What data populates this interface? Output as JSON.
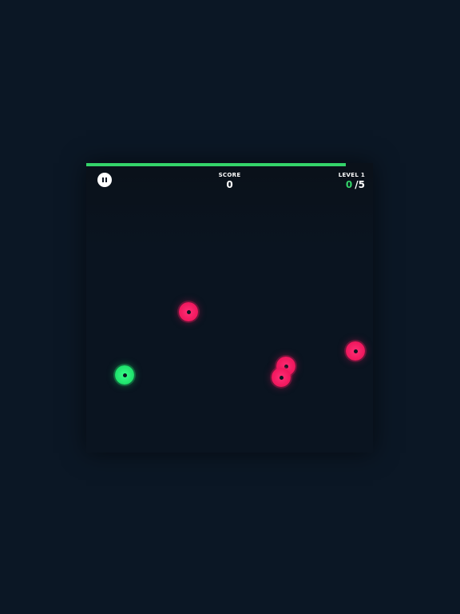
{
  "hud": {
    "score_label": "SCORE",
    "score_value": "0",
    "level_label": "LEVEL 1",
    "collected": "0",
    "target": "/5"
  },
  "timer": {
    "fraction_remaining": 0.905,
    "color": "#34d46a"
  },
  "colors": {
    "background": "#0b1725",
    "stage": "#0a1420",
    "enemy": "#f0185e",
    "player": "#1fe26c"
  },
  "icons": {
    "pause": "pause-icon"
  },
  "dots": [
    {
      "type": "enemy",
      "icon": "red-dot"
    },
    {
      "type": "enemy",
      "icon": "red-dot"
    },
    {
      "type": "enemy",
      "icon": "red-dot"
    },
    {
      "type": "enemy",
      "icon": "red-dot"
    },
    {
      "type": "player",
      "icon": "green-dot"
    }
  ]
}
